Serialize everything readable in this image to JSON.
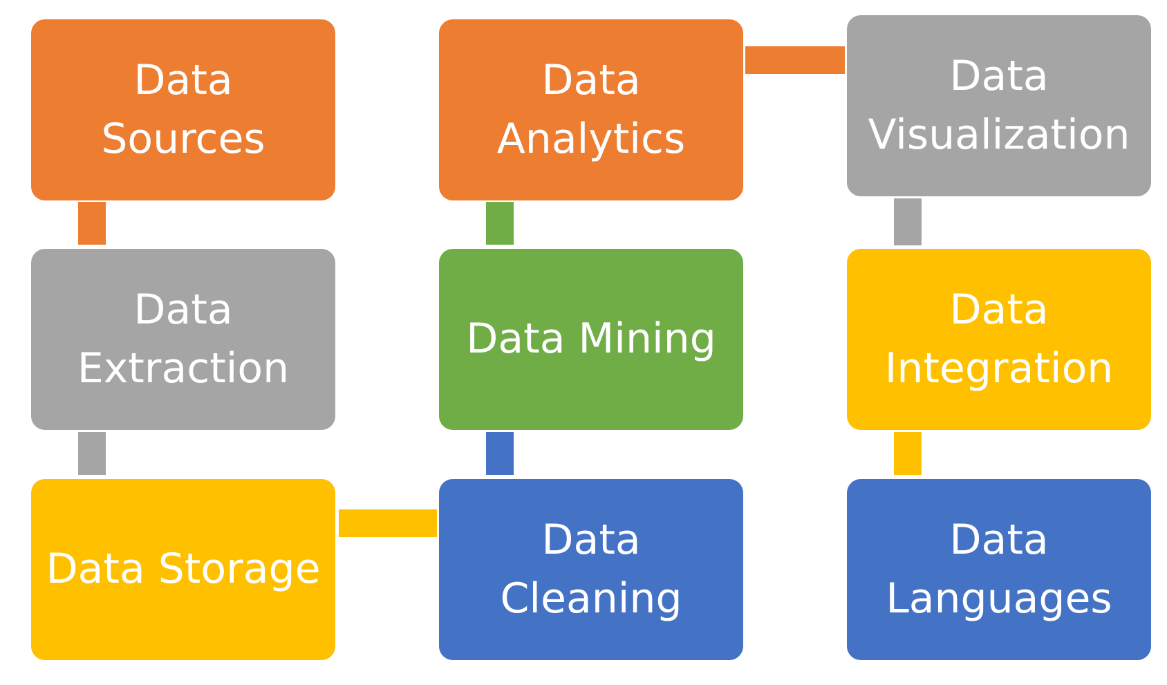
{
  "colors": {
    "orange": "#ED7D31",
    "gray": "#A5A5A5",
    "gold": "#FFC000",
    "green": "#70AD47",
    "blue": "#4472C4"
  },
  "boxes": {
    "sources": {
      "label": "Data\nSources",
      "color": "#ED7D31"
    },
    "analytics": {
      "label": "Data\nAnalytics",
      "color": "#ED7D31"
    },
    "visualization": {
      "label": "Data\nVisualization",
      "color": "#A5A5A5"
    },
    "extraction": {
      "label": "Data\nExtraction",
      "color": "#A5A5A5"
    },
    "mining": {
      "label": "Data Mining",
      "color": "#70AD47"
    },
    "integration": {
      "label": "Data\nIntegration",
      "color": "#FFC000"
    },
    "storage": {
      "label": "Data Storage",
      "color": "#FFC000"
    },
    "cleaning": {
      "label": "Data\nCleaning",
      "color": "#4472C4"
    },
    "languages": {
      "label": "Data\nLanguages",
      "color": "#4472C4"
    }
  },
  "connectors": {
    "sources_extraction": {
      "color": "#ED7D31"
    },
    "extraction_storage": {
      "color": "#A5A5A5"
    },
    "storage_cleaning": {
      "color": "#FFC000"
    },
    "cleaning_mining": {
      "color": "#4472C4"
    },
    "mining_analytics": {
      "color": "#70AD47"
    },
    "analytics_visualization": {
      "color": "#ED7D31"
    },
    "visualization_integration": {
      "color": "#A5A5A5"
    },
    "integration_languages": {
      "color": "#FFC000"
    }
  }
}
